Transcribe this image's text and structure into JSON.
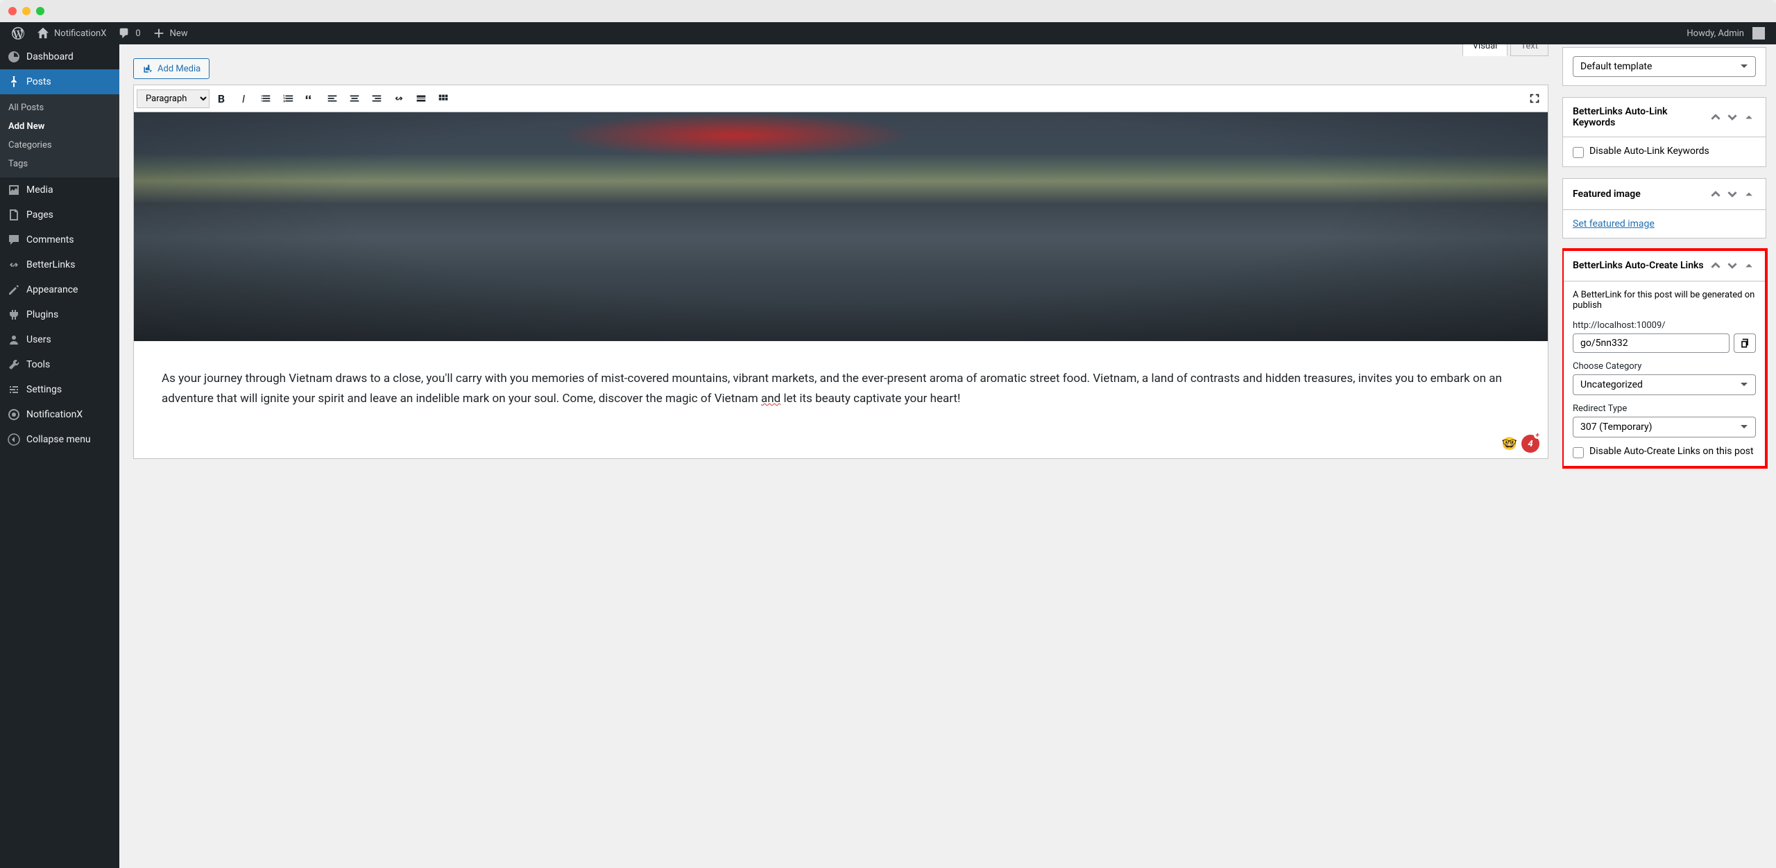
{
  "adminbar": {
    "site_name": "NotificationX",
    "comments_count": "0",
    "new_label": "New",
    "howdy": "Howdy, Admin"
  },
  "sidebar": {
    "items": [
      {
        "icon": "dashboard",
        "label": "Dashboard"
      },
      {
        "icon": "pin",
        "label": "Posts",
        "active": true,
        "submenu": [
          {
            "label": "All Posts"
          },
          {
            "label": "Add New",
            "current": true
          },
          {
            "label": "Categories"
          },
          {
            "label": "Tags"
          }
        ]
      },
      {
        "icon": "media",
        "label": "Media"
      },
      {
        "icon": "page",
        "label": "Pages"
      },
      {
        "icon": "comment",
        "label": "Comments"
      },
      {
        "icon": "link",
        "label": "BetterLinks"
      },
      {
        "icon": "appearance",
        "label": "Appearance"
      },
      {
        "icon": "plugin",
        "label": "Plugins"
      },
      {
        "icon": "user",
        "label": "Users"
      },
      {
        "icon": "tool",
        "label": "Tools"
      },
      {
        "icon": "settings",
        "label": "Settings"
      },
      {
        "icon": "notificationx",
        "label": "NotificationX"
      },
      {
        "icon": "collapse",
        "label": "Collapse menu"
      }
    ]
  },
  "editor": {
    "add_media": "Add Media",
    "tab_visual": "Visual",
    "tab_text": "Text",
    "format_select": "Paragraph",
    "body_pre": "As your journey through Vietnam draws to a close, you'll carry with you memories of mist-covered mountains, vibrant markets, and the ever-present aroma of aromatic street food. Vietnam, a land of contrasts and hidden treasures, invites you to embark on an adventure that will ignite your spirit and leave an indelible mark on your soul. Come, discover the magic of Vietnam ",
    "body_wavy": "and",
    "body_post": " let its beauty captivate your heart!",
    "badge_count": "4"
  },
  "right": {
    "template_select": "Default template",
    "box_keywords_title": "BetterLinks Auto-Link Keywords",
    "box_keywords_checkbox": "Disable Auto-Link Keywords",
    "box_featured_title": "Featured image",
    "box_featured_link": "Set featured image",
    "box_autocreate_title": "BetterLinks Auto-Create Links",
    "box_autocreate_desc": "A BetterLink for this post will be generated on publish",
    "box_autocreate_baseurl": "http://localhost:10009/",
    "box_autocreate_slug": "go/5nn332",
    "box_autocreate_category_label": "Choose Category",
    "box_autocreate_category_value": "Uncategorized",
    "box_autocreate_redirect_label": "Redirect Type",
    "box_autocreate_redirect_value": "307 (Temporary)",
    "box_autocreate_disable": "Disable Auto-Create Links on this post"
  }
}
